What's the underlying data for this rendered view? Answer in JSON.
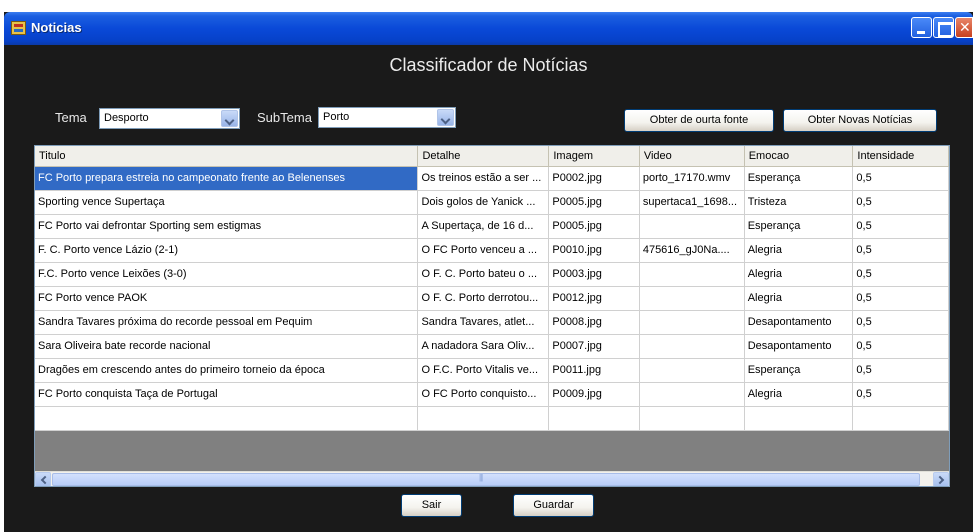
{
  "window": {
    "title": "Noticias"
  },
  "heading": "Classificador de Notícias",
  "filters": {
    "tema_label": "Tema",
    "tema_value": "Desporto",
    "subtema_label": "SubTema",
    "subtema_value": "Porto"
  },
  "buttons": {
    "outra_fonte": "Obter de ourta fonte",
    "novas": "Obter Novas Notícias",
    "sair": "Sair",
    "guardar": "Guardar"
  },
  "table": {
    "columns": [
      "Titulo",
      "Detalhe",
      "Imagem",
      "Video",
      "Emocao",
      "Intensidade"
    ],
    "rows": [
      [
        "FC Porto prepara estreia no campeonato frente ao Belenenses",
        "Os treinos estão a ser ...",
        "P0002.jpg",
        "porto_17170.wmv",
        "Esperança",
        "0,5"
      ],
      [
        "Sporting vence Supertaça",
        "Dois golos de Yanick ...",
        "P0005.jpg",
        "supertaca1_1698...",
        "Tristeza",
        "0,5"
      ],
      [
        "FC Porto vai defrontar Sporting sem estigmas",
        "A Supertaça, de 16 d...",
        "P0005.jpg",
        "",
        "Esperança",
        "0,5"
      ],
      [
        "F. C. Porto vence Lázio (2-1)",
        "O FC Porto venceu a ...",
        "P0010.jpg",
        "475616_gJ0Na....",
        "Alegria",
        "0,5"
      ],
      [
        "F.C. Porto vence Leixões (3-0)",
        "O F. C. Porto bateu o ...",
        "P0003.jpg",
        "",
        "Alegria",
        "0,5"
      ],
      [
        "FC Porto vence PAOK",
        "O F. C. Porto derrotou...",
        "P0012.jpg",
        "",
        "Alegria",
        "0,5"
      ],
      [
        "Sandra Tavares próxima do recorde pessoal em Pequim",
        "Sandra Tavares, atlet...",
        "P0008.jpg",
        "",
        "Desapontamento",
        "0,5"
      ],
      [
        "Sara Oliveira bate recorde nacional",
        "A nadadora Sara Oliv...",
        "P0007.jpg",
        "",
        "Desapontamento",
        "0,5"
      ],
      [
        "Dragões em crescendo antes do primeiro torneio da época",
        "O F.C. Porto Vitalis ve...",
        "P0011.jpg",
        "",
        "Esperança",
        "0,5"
      ],
      [
        "FC Porto conquista Taça de Portugal",
        "O FC Porto conquisto...",
        "P0009.jpg",
        "",
        "Alegria",
        "0,5"
      ],
      [
        "",
        "",
        "",
        "",
        "",
        ""
      ]
    ]
  }
}
